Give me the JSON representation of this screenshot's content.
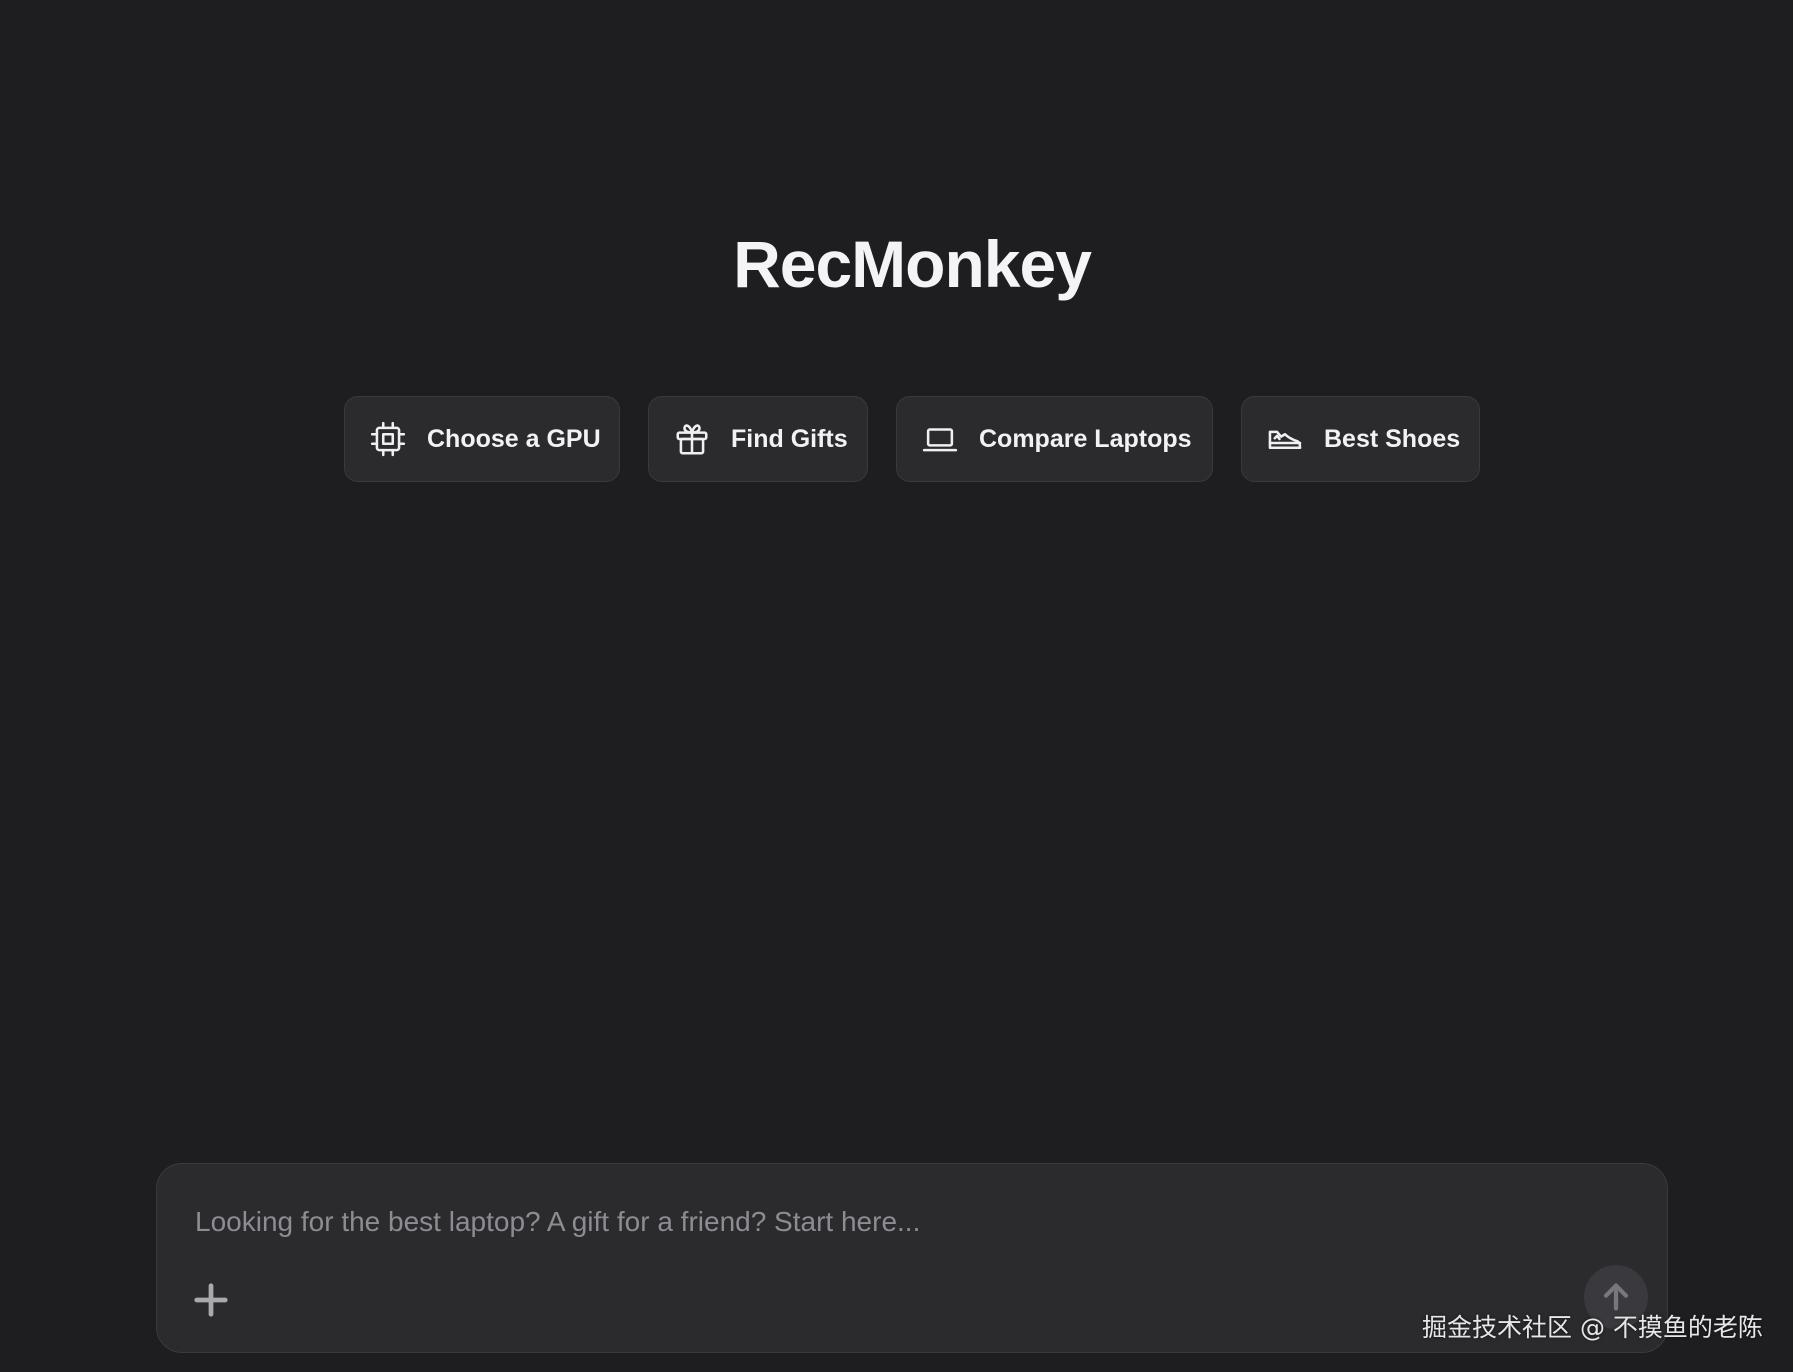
{
  "app": {
    "title": "RecMonkey"
  },
  "suggestions": [
    {
      "label": "Choose a GPU",
      "icon": "cpu-chip-icon"
    },
    {
      "label": "Find Gifts",
      "icon": "gift-icon"
    },
    {
      "label": "Compare Laptops",
      "icon": "laptop-icon"
    },
    {
      "label": "Best Shoes",
      "icon": "shoe-icon"
    }
  ],
  "composer": {
    "placeholder": "Looking for the best laptop? A gift for a friend? Start here...",
    "value": "",
    "add_icon": "plus-icon",
    "send_icon": "arrow-up-icon"
  },
  "watermark": {
    "text": "掘金技术社区 @ 不摸鱼的老陈"
  },
  "colors": {
    "background": "#1e1e20",
    "surface": "#2b2b2e",
    "border": "#3a3a3e",
    "text": "#f2f2f4",
    "placeholder": "#8c8c92"
  }
}
